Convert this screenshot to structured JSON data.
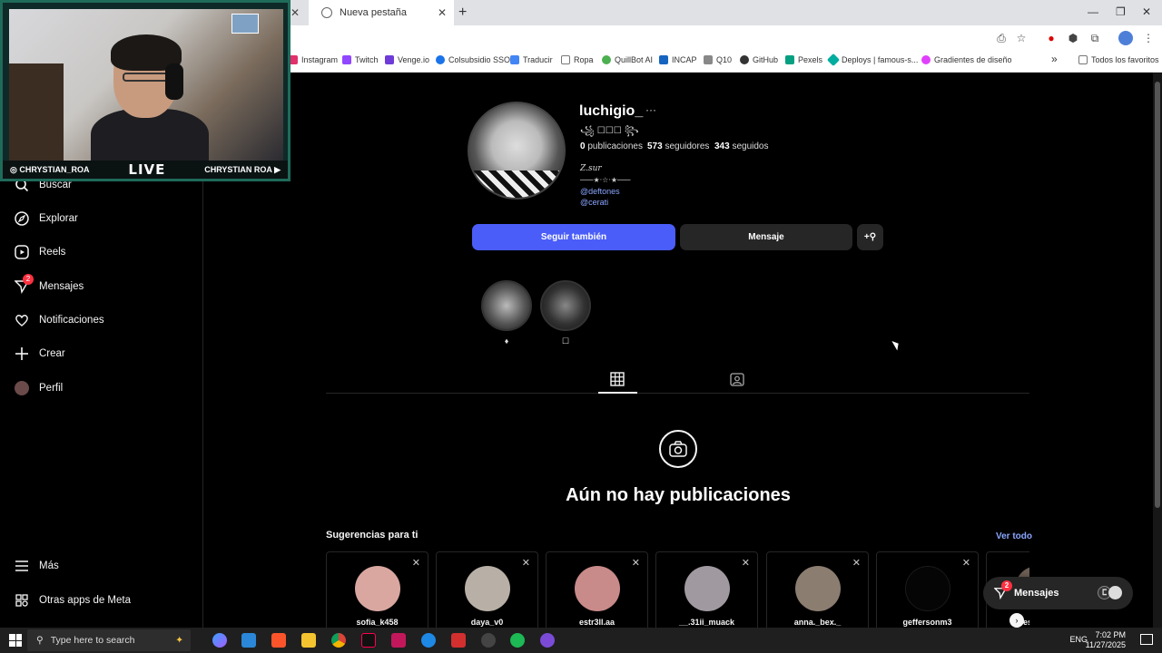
{
  "browser": {
    "tab_title": "Nueva pestaña",
    "new_tab_symbol": "+",
    "close_symbol": "✕",
    "bookmarks": [
      {
        "label": "Instagram",
        "color": "#e1306c"
      },
      {
        "label": "Twitch",
        "color": "#9146ff"
      },
      {
        "label": "Venge.io",
        "color": "#6f3bd8"
      },
      {
        "label": "Colsubsidio SSO",
        "color": "#1a73e8"
      },
      {
        "label": "Traducir",
        "color": "#4285f4"
      },
      {
        "label": "Ropa",
        "color": "#777777"
      },
      {
        "label": "QuillBot AI",
        "color": "#4caf50"
      },
      {
        "label": "INCAP",
        "color": "#1565c0"
      },
      {
        "label": "Q10",
        "color": "#888888"
      },
      {
        "label": "GitHub",
        "color": "#333333"
      },
      {
        "label": "Pexels",
        "color": "#05a081"
      },
      {
        "label": "Deploys | famous-s...",
        "color": "#00ad9f"
      },
      {
        "label": "Gradientes de diseño",
        "color": "#e040fb"
      }
    ],
    "bookmarks_overflow": "»",
    "all_favorites": "Todos los favoritos"
  },
  "webcam": {
    "handle_left": "CHRYSTIAN_ROA",
    "live": "LIVE",
    "handle_right": "CHRYSTIAN ROA"
  },
  "sidebar": {
    "items": [
      {
        "label": "Buscar",
        "icon": "search-icon"
      },
      {
        "label": "Explorar",
        "icon": "compass-icon"
      },
      {
        "label": "Reels",
        "icon": "reels-icon"
      },
      {
        "label": "Mensajes",
        "icon": "messenger-icon",
        "badge": "2"
      },
      {
        "label": "Notificaciones",
        "icon": "heart-icon"
      },
      {
        "label": "Crear",
        "icon": "plus-icon"
      },
      {
        "label": "Perfil",
        "icon": "avatar-icon"
      }
    ],
    "more": "Más",
    "meta_apps": "Otras apps de Meta"
  },
  "profile": {
    "username": "luchigio_",
    "more": "···",
    "fancy_name": "꧁ ☐☐☐ ꧂",
    "posts_count": "0",
    "posts_label": "publicaciones",
    "followers_count": "573",
    "followers_label": "seguidores",
    "following_count": "343",
    "following_label": "seguidos",
    "bio_line1": "Z.sur",
    "bio_line2": "───★·☆·★───",
    "links": [
      "@deftones",
      "@cerati"
    ],
    "follow_button": "Seguir también",
    "message_button": "Mensaje",
    "add_person_button": "+⚲",
    "highlights": [
      {
        "label": "♦"
      },
      {
        "label": "☐"
      }
    ]
  },
  "content": {
    "no_posts": "Aún no hay publicaciones",
    "suggestions_title": "Sugerencias para ti",
    "see_all": "Ver todo",
    "suggestions": [
      {
        "name": "sofia_k458",
        "color": "#d9a7a0"
      },
      {
        "name": "daya_v0",
        "color": "#b8b0a6"
      },
      {
        "name": "estr3ll.aa",
        "color": "#c98a8a"
      },
      {
        "name": "__.31ii_muack",
        "color": "#a09aa0"
      },
      {
        "name": "anna._bex._",
        "color": "#8b7d70"
      },
      {
        "name": "geffersonm3",
        "color": "#050505"
      },
      {
        "name": "es",
        "color": "#6d5f55"
      }
    ]
  },
  "floating_messages": {
    "label": "Mensajes",
    "badge": "2"
  },
  "taskbar": {
    "search_placeholder": "Type here to search",
    "language": "ENG",
    "time": "7:02 PM",
    "date": "11/27/2025"
  }
}
